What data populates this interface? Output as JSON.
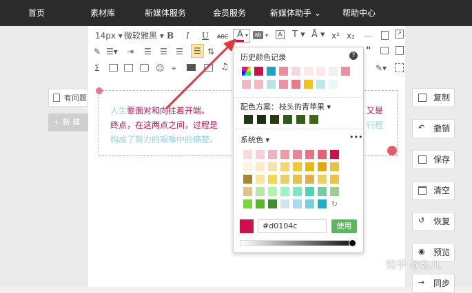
{
  "nav": {
    "items": [
      "首页",
      "素材库",
      "新媒体服务",
      "会员服务",
      "新媒体助手 ⌄",
      "帮助中心"
    ]
  },
  "toolbar": {
    "font_size": "14px ▾",
    "font_family": "微软雅黑 ▾"
  },
  "sidebar": {
    "question_label": "有问题",
    "new_label": "+ 新 建"
  },
  "editor": {
    "line1_a": "人生",
    "line1_b": "要面对和向往着开端。",
    "line1_end": "又是",
    "line2_a": "终点，在这两点之间，过程是",
    "line2_end": "行程",
    "line3_a": "构成了努力的艰难中的痛楚。"
  },
  "picker": {
    "history_title": "历史颜色记录",
    "scheme_label": "配色方案：",
    "scheme_value": "枝头的青苹果 ▾",
    "system_label": "系统色 ▾",
    "more": "•••",
    "hex_value": "#d0104c",
    "use_label": "使用",
    "current_color": "#d0104c",
    "history_row1": [
      "rainbow",
      "#d0104c",
      "#1aa5c8",
      "#ec8c9c",
      "#fbd7dc",
      "#fde8eb",
      "#fce8ee",
      "#f0f0f0",
      "#ef8ea0"
    ],
    "history_row2": [
      "#f4b7c1",
      "#f5b6c0",
      "#b8e2ef",
      "#f08f9f",
      "#e87a8a",
      "#f3c21b",
      "#bfe6ef",
      "#eaf6f9"
    ],
    "scheme_colors": [
      "#1e3a0f",
      "#1d2f10",
      "#2a3a0c",
      "#2e5b1a",
      "#355e1b",
      "#3c6a12"
    ],
    "system_rows": [
      [
        "#fadadd",
        "#f8d0d4",
        "#f4b1bb",
        "#f09aa6",
        "#eb8493",
        "#e87182",
        "#e65f72",
        "#d0104c"
      ],
      [
        "#fdf4e1",
        "#fcebc6",
        "#f8e2a8",
        "#f7d76a",
        "#f1c92c",
        "#e8b811",
        "#e2a80c",
        "#e8c247"
      ],
      [
        "#a8852e",
        "#f6e59c",
        "#f2d74f",
        "#ead062",
        "#e7c24a",
        "#e0b04d",
        "#f0d05a",
        "#f0c040"
      ],
      [
        "#e2c38b",
        "#b9e6a6",
        "#b0f4a6",
        "#9af5c4",
        "#7fe5c4",
        "#4bd6b1",
        "#6fcf9f",
        "#9ad08d"
      ],
      [
        "#7bd53b",
        "#5bb62a",
        "#3d8f29",
        "#cfe5f2",
        "#a9dbef",
        "#75cfe2",
        "#1fb0c8",
        "refresh"
      ]
    ]
  },
  "right_buttons": [
    "复制",
    "撤销",
    "保存",
    "清空",
    "恢复",
    "预览",
    "同步"
  ],
  "watermark": "知乎 @幺儿",
  "colors": {
    "accent_red": "#d0104c",
    "arrow": "#e0393b",
    "use_button": "#5cb85c"
  }
}
